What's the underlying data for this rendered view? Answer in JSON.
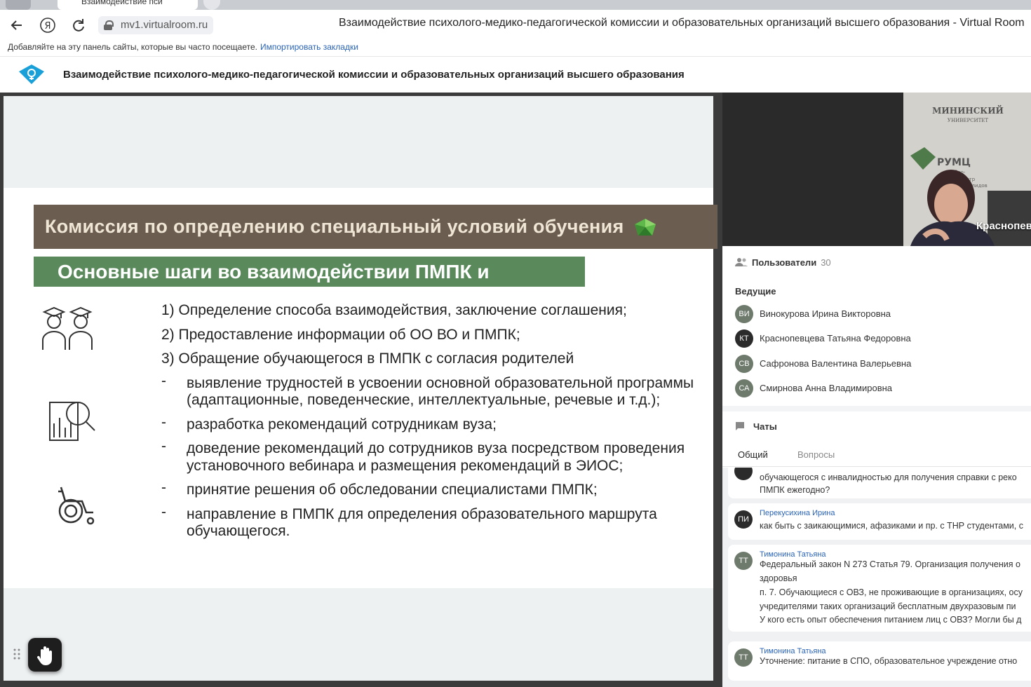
{
  "browser": {
    "url": "mv1.virtualroom.ru",
    "window_title": "Взаимодействие психолого-медико-педагогической комиссии и образовательных организаций высшего образования - Virtual Room",
    "bookmarks_hint": "Добавляйте на эту панель сайты, которые вы часто посещаете.",
    "bookmarks_import": "Импортировать закладки",
    "tab_title": "Взаимодействие пси"
  },
  "app": {
    "title": "Взаимодействие психолого-медико-педагогической комиссии и образовательных организаций высшего образования"
  },
  "slide": {
    "heading": "Комиссия по определению специальный условий обучения",
    "subheading": "Основные шаги во взаимодействии ПМПК и",
    "numbered": [
      "1) Определение способа взаимодействия, заключение соглашения;",
      "2) Предоставление информации об ОО ВО и ПМПК;",
      "3) Обращение обучающегося в ПМПК с согласия родителей"
    ],
    "dashes": [
      "выявление трудностей в усвоении основной образовательной программы (адаптационные, поведенческие, интеллектуальные, речевые и т.д.);",
      "разработка рекомендаций сотрудникам вуза;",
      "доведение рекомендаций до сотрудников вуза посредством проведения установочного вебинара и размещения рекомендаций в ЭИОС;",
      "принятие решения об обследовании специалистами ПМПК;",
      "направление в ПМПК для определения образовательного маршрута обучающегося."
    ]
  },
  "video": {
    "speaker_label": "Краснопев",
    "background_text": [
      "МИНИНСКИЙ",
      "УНИВЕРСИТЕТ",
      "РУМЦ",
      "учебно-",
      "центр",
      "инвалидов"
    ]
  },
  "users": {
    "title": "Пользователи",
    "count": "30",
    "section": "Ведущие",
    "list": [
      {
        "initials": "ВИ",
        "name": "Винокурова Ирина Викторовна"
      },
      {
        "initials": "КТ",
        "name": "Краснопевцева Татьяна Федоровна"
      },
      {
        "initials": "СВ",
        "name": "Сафронова Валентина Валерьевна"
      },
      {
        "initials": "СА",
        "name": "Смирнова Анна Владимировна"
      }
    ]
  },
  "chat": {
    "title": "Чаты",
    "tabs": [
      "Общий",
      "Вопросы"
    ],
    "messages": [
      {
        "initials": "",
        "author": "",
        "lines": [
          "обучающегося с инвалидностью для получения справки с реко",
          "ПМПК ежегодно?"
        ]
      },
      {
        "initials": "ПИ",
        "author": "Перекусихина Ирина",
        "lines": [
          "как быть с заикающимися, афазиками и пр. с ТНР студентами, с"
        ]
      },
      {
        "initials": "ТТ",
        "author": "Тимонина Татьяна",
        "lines": [
          "Федеральный закон N 273 Статья 79. Организация получения о",
          "здоровья",
          "п. 7. Обучающиеся с ОВЗ, не проживающие в организациях, осу",
          "учредителями таких организаций бесплатным двухразовым пи",
          "У кого есть опыт обеспечения питанием лиц с ОВЗ? Могли бы д"
        ]
      },
      {
        "initials": "ТТ",
        "author": "Тимонина Татьяна",
        "lines": [
          "Уточнение: питание в СПО, образовательное учреждение отно"
        ]
      }
    ]
  },
  "colors": {
    "heading_brown": "#6b5d50",
    "heading_green": "#5a8a5c",
    "link_blue": "#2a64b8",
    "logo_blue": "#1aa0d8"
  }
}
